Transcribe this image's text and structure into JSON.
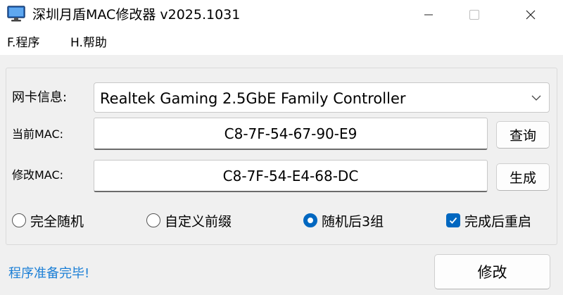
{
  "window": {
    "title": "深圳月盾MAC修改器 v2025.1031",
    "icon": "monitor-icon"
  },
  "menu": {
    "file": "F.程序",
    "help": "H.帮助"
  },
  "form": {
    "nic_label": "网卡信息:",
    "nic_value": "Realtek Gaming 2.5GbE Family Controller",
    "current_mac_label": "当前MAC:",
    "current_mac_value": "C8-7F-54-67-90-E9",
    "query_button": "查询",
    "modify_mac_label": "修改MAC:",
    "modify_mac_value": "C8-7F-54-E4-68-DC",
    "generate_button": "生成"
  },
  "options": {
    "full_random": {
      "label": "完全随机",
      "checked": false
    },
    "custom_prefix": {
      "label": "自定义前缀",
      "checked": false
    },
    "random_last3": {
      "label": "随机后3组",
      "checked": true
    },
    "restart_after": {
      "label": "完成后重启",
      "checked": true
    }
  },
  "status": {
    "text": "程序准备完毕!",
    "color": "#1b7fd6"
  },
  "actions": {
    "modify_button": "修改"
  },
  "colors": {
    "accent": "#0067c0",
    "window_bg": "#f0f0f0"
  }
}
